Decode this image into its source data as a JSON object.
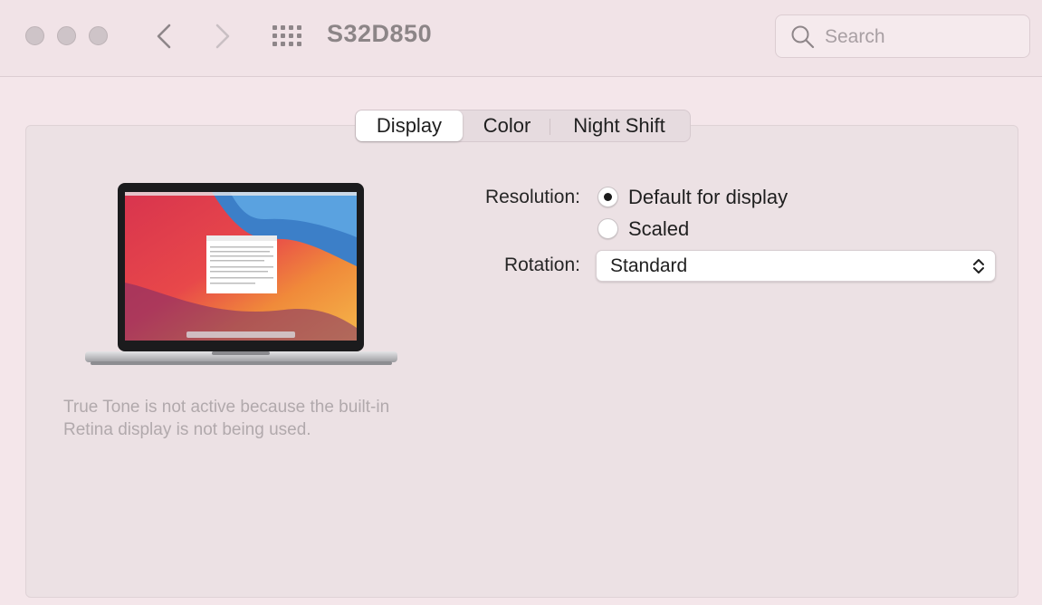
{
  "window": {
    "title": "S32D850"
  },
  "toolbar": {
    "traffic_lights": [
      "close",
      "minimize",
      "zoom"
    ],
    "back_icon": "chevron-left-icon",
    "forward_icon": "chevron-right-icon",
    "show_all_icon": "grid-icon"
  },
  "search": {
    "placeholder": "Search",
    "icon": "search-icon"
  },
  "tabs": [
    {
      "label": "Display",
      "active": true
    },
    {
      "label": "Color",
      "active": false
    },
    {
      "label": "Night Shift",
      "active": false
    }
  ],
  "display_preview": {
    "image": "macbook-pro-image",
    "note": "True Tone is not active because the built-in Retina display is not being used."
  },
  "resolution": {
    "label": "Resolution:",
    "options": [
      {
        "label": "Default for display",
        "selected": true
      },
      {
        "label": "Scaled",
        "selected": false
      }
    ]
  },
  "rotation": {
    "label": "Rotation:",
    "value": "Standard"
  }
}
